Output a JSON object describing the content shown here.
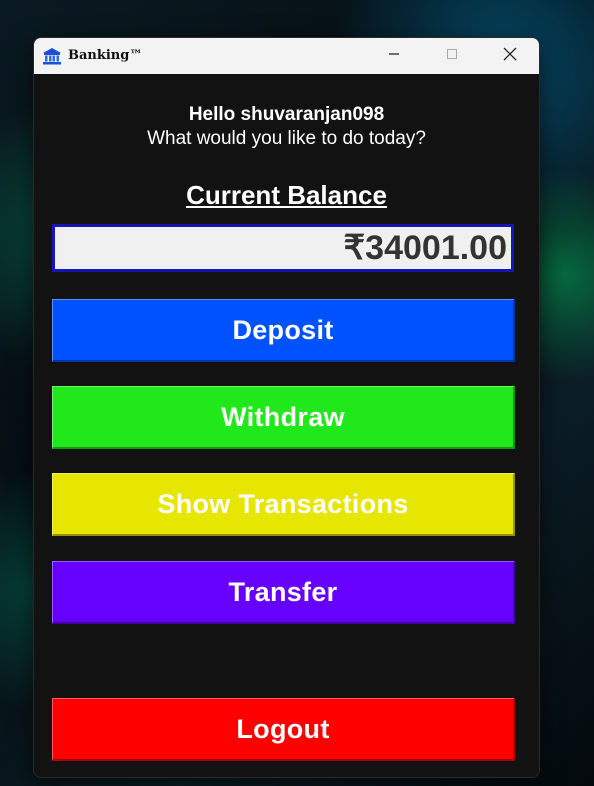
{
  "window": {
    "title": "Banking™",
    "icon": "bank-icon"
  },
  "controls": {
    "minimize_icon": "minimize-icon",
    "maximize_icon": "maximize-icon",
    "close_icon": "close-icon"
  },
  "main": {
    "greeting": "Hello shuvaranjan098",
    "question": "What would you like to do today?",
    "balance_heading": "Current Balance",
    "balance_value": "₹34001.00"
  },
  "buttons": {
    "deposit": "Deposit",
    "withdraw": "Withdraw",
    "show_transactions": "Show Transactions",
    "transfer": "Transfer",
    "logout": "Logout"
  },
  "colors": {
    "deposit": "#0052ff",
    "withdraw": "#20e81a",
    "show_transactions": "#e6e600",
    "transfer": "#6600ff",
    "logout": "#ff0000",
    "balance_border": "#1417b5",
    "window_bg": "#121212"
  }
}
